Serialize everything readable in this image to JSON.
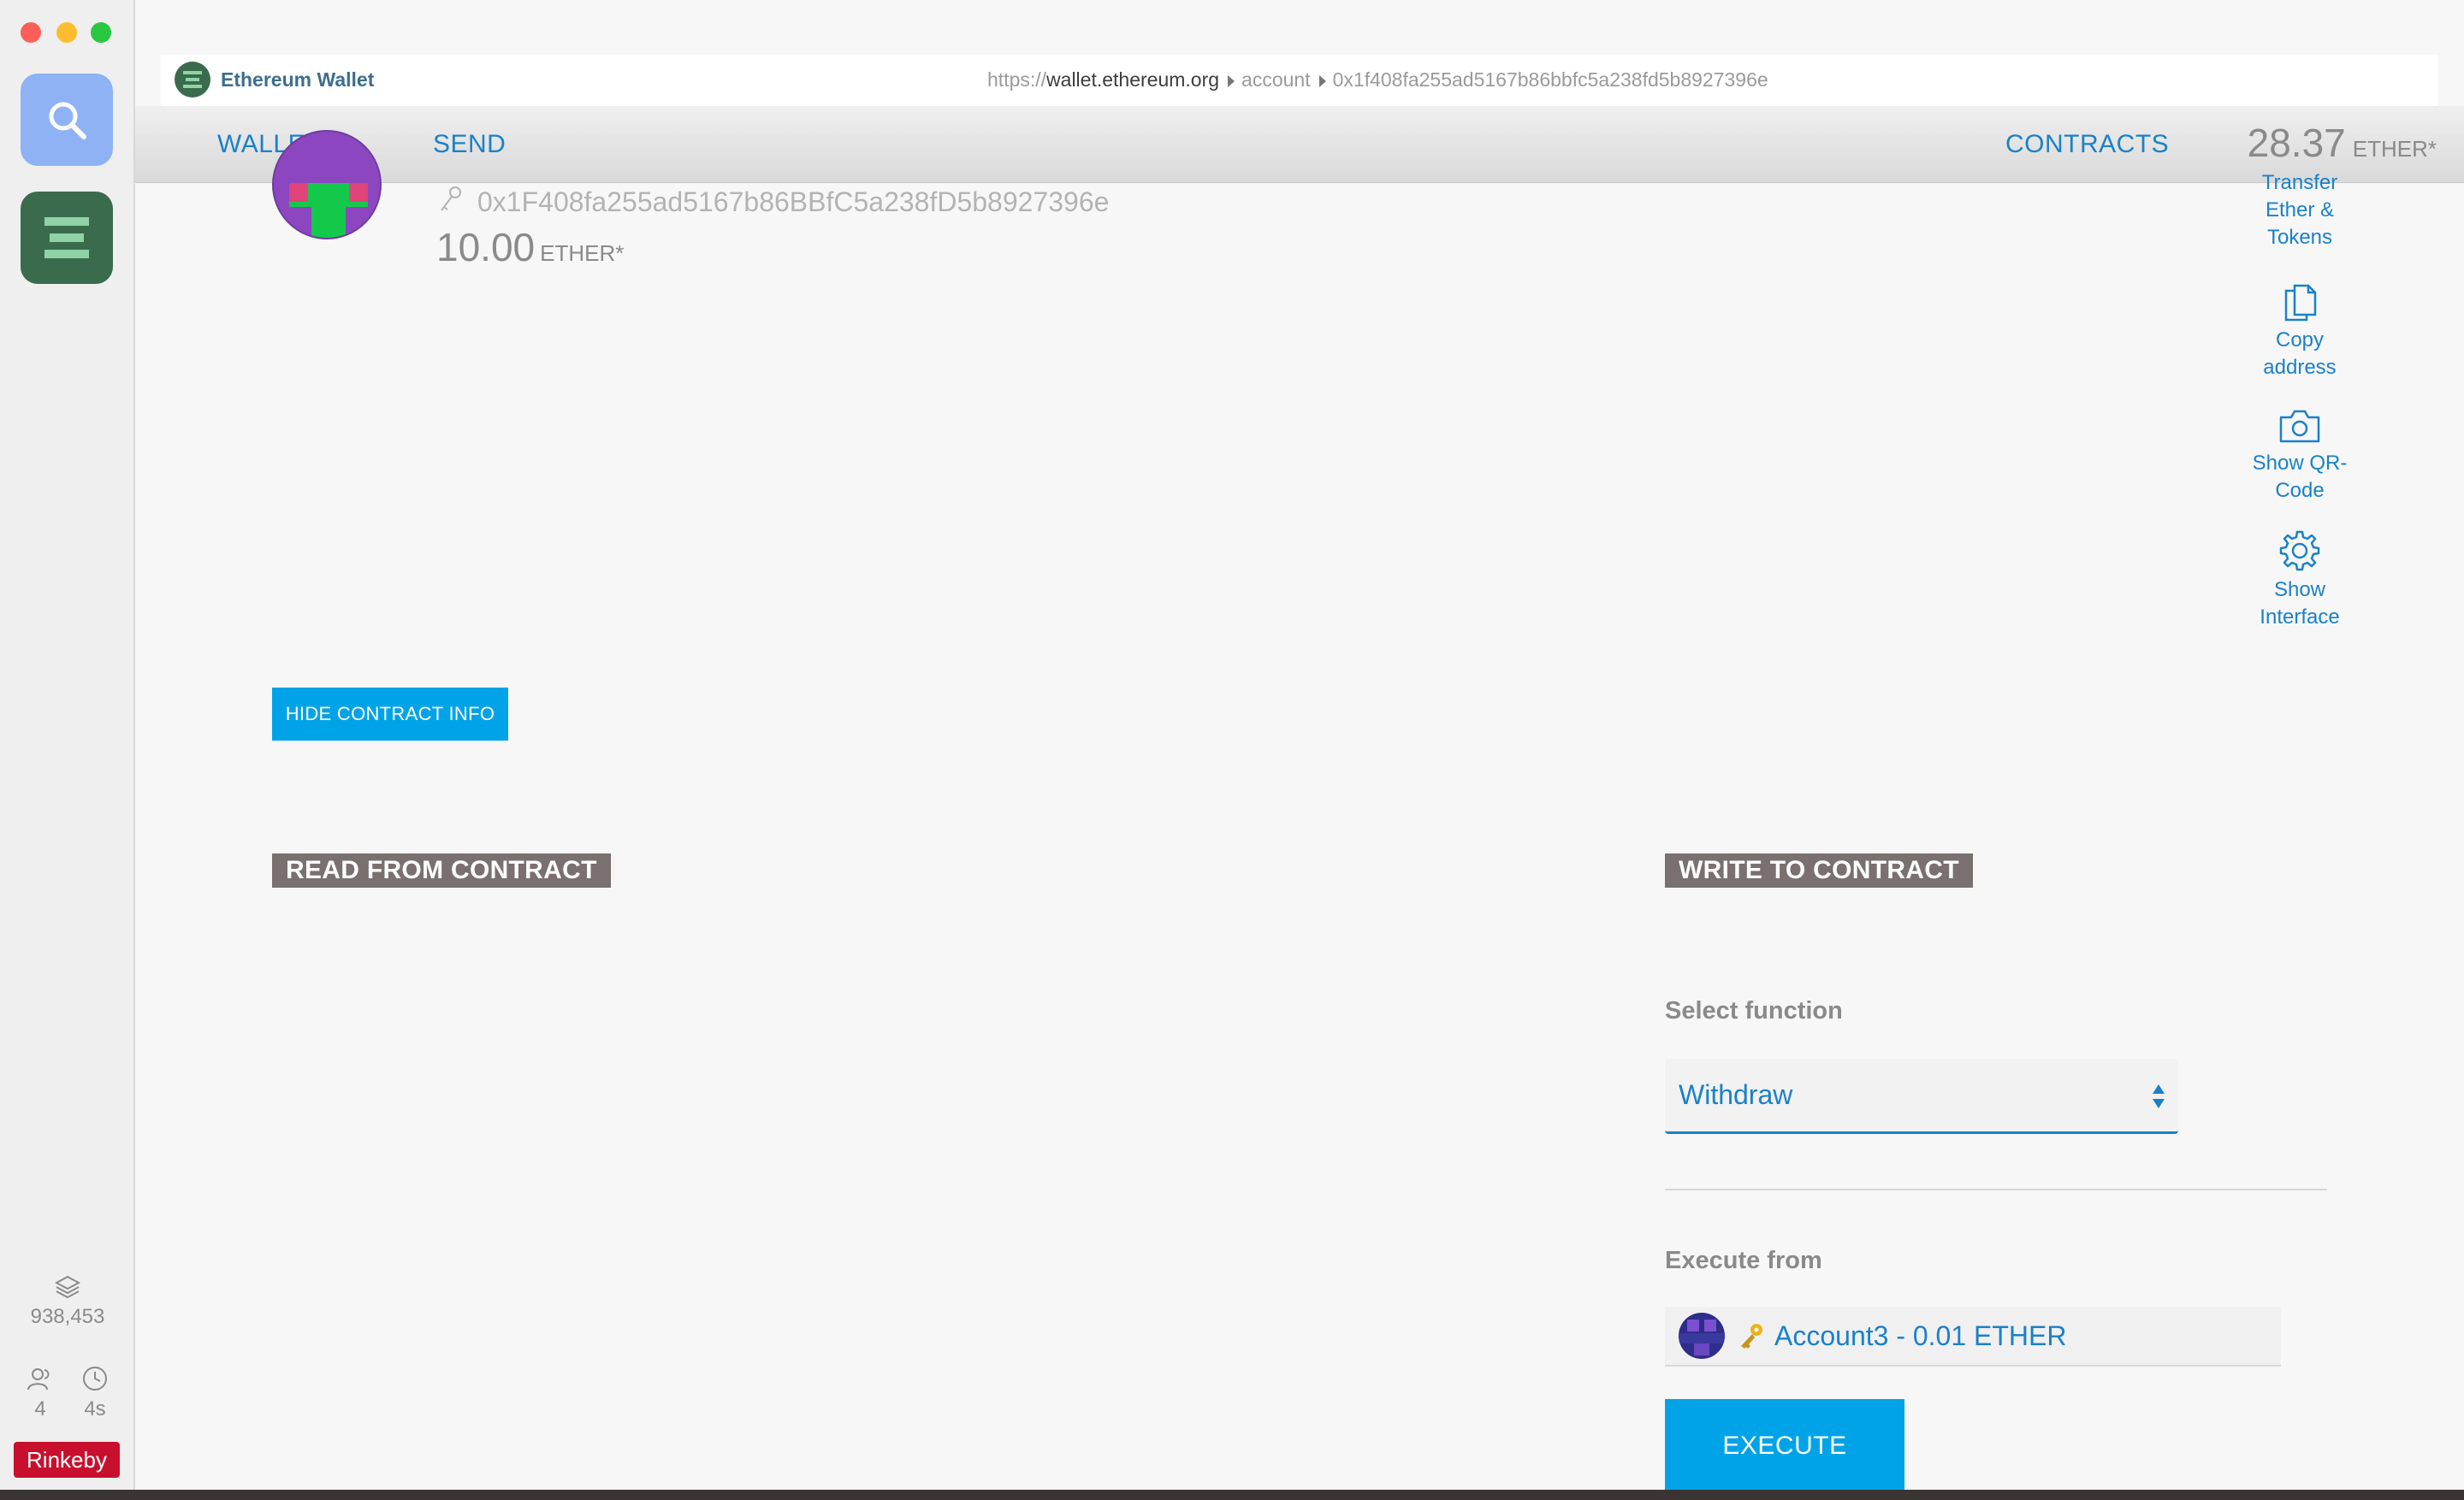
{
  "app": {
    "title": "Ethereum Wallet"
  },
  "url": {
    "scheme": "https://",
    "host": "wallet.ethereum.org",
    "path1": "account",
    "path2": "0x1f408fa255ad5167b86bbfc5a238fd5b8927396e"
  },
  "dock": {
    "block_number": "938,453",
    "peers": "4",
    "block_time": "4s",
    "network": "Rinkeby"
  },
  "nav": {
    "wallets": "WALLETS",
    "send": "SEND",
    "contracts": "CONTRACTS",
    "balance_amount": "28.37",
    "balance_unit": "ETHER*"
  },
  "account": {
    "address": "0x1F408fa255ad5167b86BBfC5a238fD5b8927396e",
    "balance_amount": "10.00",
    "balance_unit": "ETHER*"
  },
  "actions": {
    "transfer": [
      "Transfer",
      "Ether &",
      "Tokens"
    ],
    "copy": [
      "Copy",
      "address"
    ],
    "qr": [
      "Show QR-",
      "Code"
    ],
    "interface": [
      "Show",
      "Interface"
    ]
  },
  "contract": {
    "hide_info_label": "HIDE CONTRACT INFO",
    "read_title": "READ FROM CONTRACT",
    "write_title": "WRITE TO CONTRACT",
    "select_function_label": "Select function",
    "selected_function": "Withdraw",
    "execute_from_label": "Execute from",
    "selected_account": "Account3 - 0.01 ETHER",
    "execute_label": "EXECUTE"
  },
  "colors": {
    "accent": "#1a81c9",
    "button": "#00a3e8",
    "section_title_bg": "#7a7070",
    "network_badge": "#c8102e"
  }
}
